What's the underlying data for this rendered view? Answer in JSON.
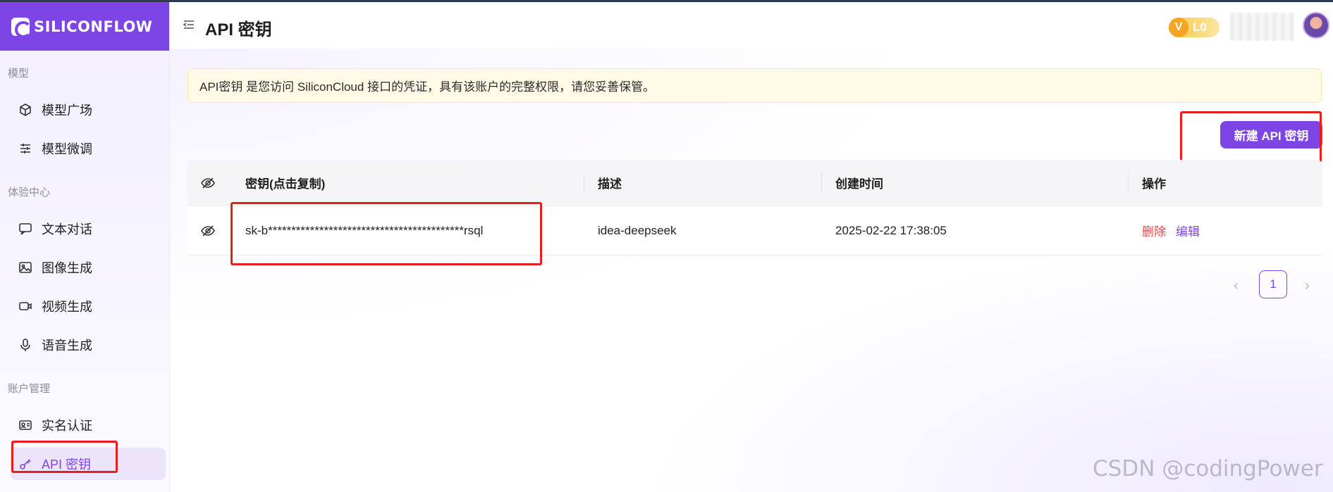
{
  "brand": {
    "name": "SILICONFLOW",
    "accent": "#7e45e6"
  },
  "sidebar": {
    "sections": [
      {
        "label": "模型",
        "items": [
          {
            "label": "模型广场",
            "icon": "cube-icon"
          },
          {
            "label": "模型微调",
            "icon": "sliders-icon"
          }
        ]
      },
      {
        "label": "体验中心",
        "items": [
          {
            "label": "文本对话",
            "icon": "chat-icon"
          },
          {
            "label": "图像生成",
            "icon": "image-icon"
          },
          {
            "label": "视频生成",
            "icon": "video-icon"
          },
          {
            "label": "语音生成",
            "icon": "microphone-icon"
          }
        ]
      },
      {
        "label": "账户管理",
        "items": [
          {
            "label": "实名认证",
            "icon": "id-card-icon"
          },
          {
            "label": "API 密钥",
            "icon": "key-icon",
            "active": true
          }
        ]
      }
    ]
  },
  "header": {
    "title": "API 密钥",
    "level": {
      "v": "V",
      "text": "L0"
    }
  },
  "notice": "API密钥 是您访问 SiliconCloud 接口的凭证，具有该账户的完整权限，请您妥善保管。",
  "new_key_button": "新建 API 密钥",
  "table": {
    "columns": [
      "密钥(点击复制)",
      "描述",
      "创建时间",
      "操作"
    ],
    "rows": [
      {
        "key": "sk-b******************************************rsql",
        "description": "idea-deepseek",
        "created_at": "2025-02-22 17:38:05",
        "actions": {
          "delete": "删除",
          "edit": "编辑"
        }
      }
    ]
  },
  "pagination": {
    "prev": "‹",
    "current": "1",
    "next": "›"
  },
  "watermark": "CSDN @codingPower"
}
